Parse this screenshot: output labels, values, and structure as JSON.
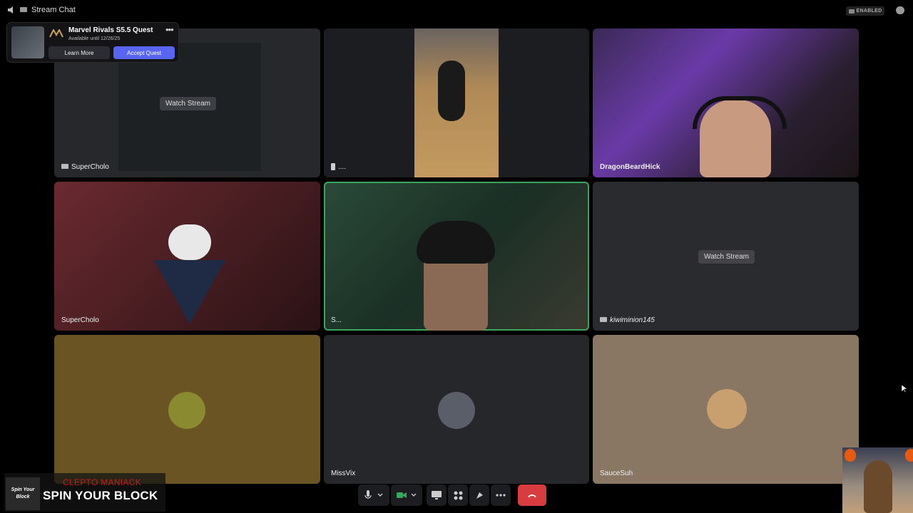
{
  "window": {
    "title": "Stream Chat",
    "enabled_label": "ENABLED"
  },
  "quest": {
    "title": "Marvel Rivals S5.5 Quest",
    "subtitle": "Available until 12/26/25",
    "learn_more": "Learn More",
    "accept": "Accept Quest"
  },
  "tiles": [
    {
      "name": "SuperCholo",
      "watch": "Watch Stream",
      "bg": "#2b2d31"
    },
    {
      "name": "....",
      "bg": "#3a3226"
    },
    {
      "name": "DragonBeardHick",
      "bg": "#2a1f3a"
    },
    {
      "name": "SuperCholo",
      "bg": "#5a2228"
    },
    {
      "name": "S...",
      "bg": "#1f3a2c"
    },
    {
      "name": "kiwiminion145",
      "watch": "Watch Stream",
      "bg": "#2b2d30"
    },
    {
      "name": "",
      "bg": "#6b5422"
    },
    {
      "name": "MissVix",
      "bg": "#26272b"
    },
    {
      "name": "SauceSuh",
      "bg": "#8a7763"
    }
  ],
  "now_playing": {
    "artist": "CLEPTO MANIACK",
    "song": "SPIN YOUR BLOCK",
    "art_text": "Spin Your Block"
  },
  "colors": {
    "accent": "#5865f2",
    "end_call": "#d83c3e",
    "speaking": "#3ba55d"
  },
  "icons": [
    "speaker-icon",
    "stream-icon",
    "mic-icon",
    "camera-icon",
    "screen-share-icon",
    "activities-icon",
    "soundboard-icon",
    "more-icon",
    "hangup-icon",
    "chat-icon",
    "phone-icon"
  ]
}
